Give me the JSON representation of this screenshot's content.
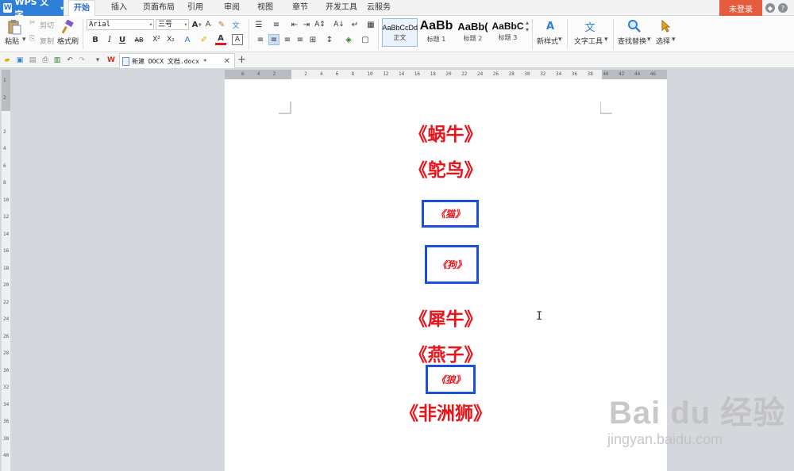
{
  "app": {
    "title": "WPS 文字",
    "menu_tabs": [
      "开始",
      "插入",
      "页面布局",
      "引用",
      "审阅",
      "视图",
      "章节",
      "开发工具",
      "云服务"
    ],
    "active_tab": "开始",
    "login_label": "未登录"
  },
  "ribbon": {
    "paste_label": "粘贴",
    "cut_label": "剪切",
    "copy_label": "复制",
    "format_painter_label": "格式刷",
    "font_name": "Arial",
    "font_size": "三号",
    "styles": [
      {
        "sample": "AaBbCcDd",
        "name": "正文"
      },
      {
        "sample": "AaBb",
        "name": "标题 1"
      },
      {
        "sample": "AaBb(",
        "name": "标题 2"
      },
      {
        "sample": "AaBbC",
        "name": "标题 3"
      }
    ],
    "new_style_label": "新样式",
    "text_tools_label": "文字工具",
    "find_replace_label": "查找替换",
    "select_label": "选择"
  },
  "document_tab": {
    "name": "新建 DOCX 文档.docx *"
  },
  "ruler": {
    "h_ticks": [
      "6",
      "4",
      "2",
      "",
      "2",
      "4",
      "6",
      "8",
      "10",
      "12",
      "14",
      "16",
      "18",
      "20",
      "22",
      "24",
      "26",
      "28",
      "30",
      "32",
      "34",
      "36",
      "38",
      "40",
      "42",
      "44",
      "46"
    ],
    "v_ticks": [
      "1",
      "2",
      "",
      "2",
      "4",
      "6",
      "8",
      "10",
      "12",
      "14",
      "16",
      "18",
      "20",
      "22",
      "24",
      "26",
      "28",
      "30",
      "32",
      "34",
      "36",
      "38",
      "40"
    ]
  },
  "document": {
    "lines": [
      {
        "text": "《蜗牛》",
        "boxed": false
      },
      {
        "text": "《鸵鸟》",
        "boxed": false
      },
      {
        "text": "《猫》",
        "boxed": true
      },
      {
        "text": "《狗》",
        "boxed": true
      },
      {
        "text": "《犀牛》",
        "boxed": false
      },
      {
        "text": "《燕子》",
        "boxed": false
      },
      {
        "text": "《狼》",
        "boxed": true
      },
      {
        "text": "《非洲狮》",
        "boxed": false
      }
    ]
  },
  "watermark": {
    "brand": "Bai du 经验",
    "url": "jingyan.baidu.com"
  },
  "colors": {
    "accent": "#2f7fd6",
    "text_red": "#e8141b",
    "box_blue": "#1a4fe0",
    "login_bg": "#e45b3e"
  }
}
